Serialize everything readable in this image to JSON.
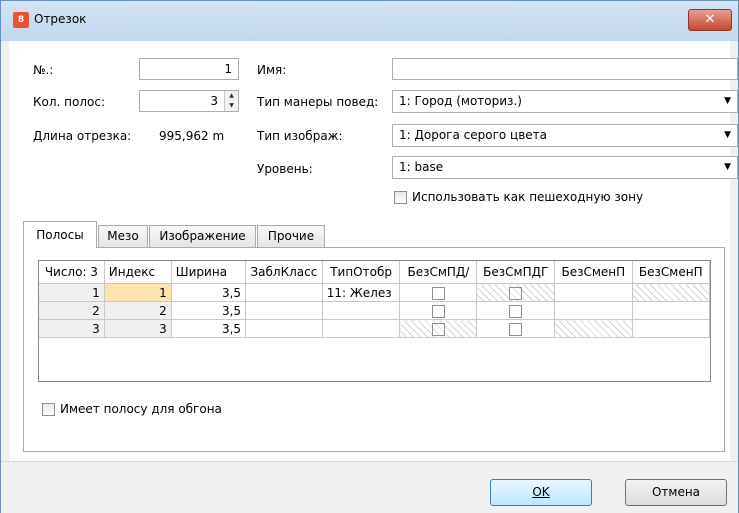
{
  "window": {
    "title": "Отрезок",
    "close_glyph": "✕"
  },
  "form": {
    "number_label": "№.:",
    "number_value": "1",
    "lanes_label": "Кол. полос:",
    "lanes_value": "3",
    "length_label": "Длина отрезка:",
    "length_value": "995,962 m",
    "name_label": "Имя:",
    "name_value": "",
    "behavior_label": "Тип манеры повед:",
    "behavior_value": "1: Город (моториз.)",
    "display_label": "Тип изображ:",
    "display_value": "1: Дорога серого цвета",
    "level_label": "Уровень:",
    "level_value": "1: base",
    "pedestrian_label": "Использовать как   пешеходную зону",
    "pedestrian_checked": false
  },
  "tabs": [
    "Полосы",
    "Мезо",
    "Изображение",
    "Прочие"
  ],
  "grid": {
    "headers": [
      "Число: 3",
      "Индекс",
      "Ширина",
      "ЗаблКласс",
      "ТипОтобр",
      "БезСмПД/",
      "БезСмПДГ",
      "БезСменП",
      "БезСменП"
    ],
    "rows": [
      {
        "num": "1",
        "index": "1",
        "width": "3,5",
        "blocked": "",
        "display": "11: Желез"
      },
      {
        "num": "2",
        "index": "2",
        "width": "3,5",
        "blocked": "",
        "display": ""
      },
      {
        "num": "3",
        "index": "3",
        "width": "3,5",
        "blocked": "",
        "display": ""
      }
    ]
  },
  "overtaking_label": "Имеет полосу для обгона",
  "buttons": {
    "ok": "OK",
    "cancel": "Отмена"
  }
}
